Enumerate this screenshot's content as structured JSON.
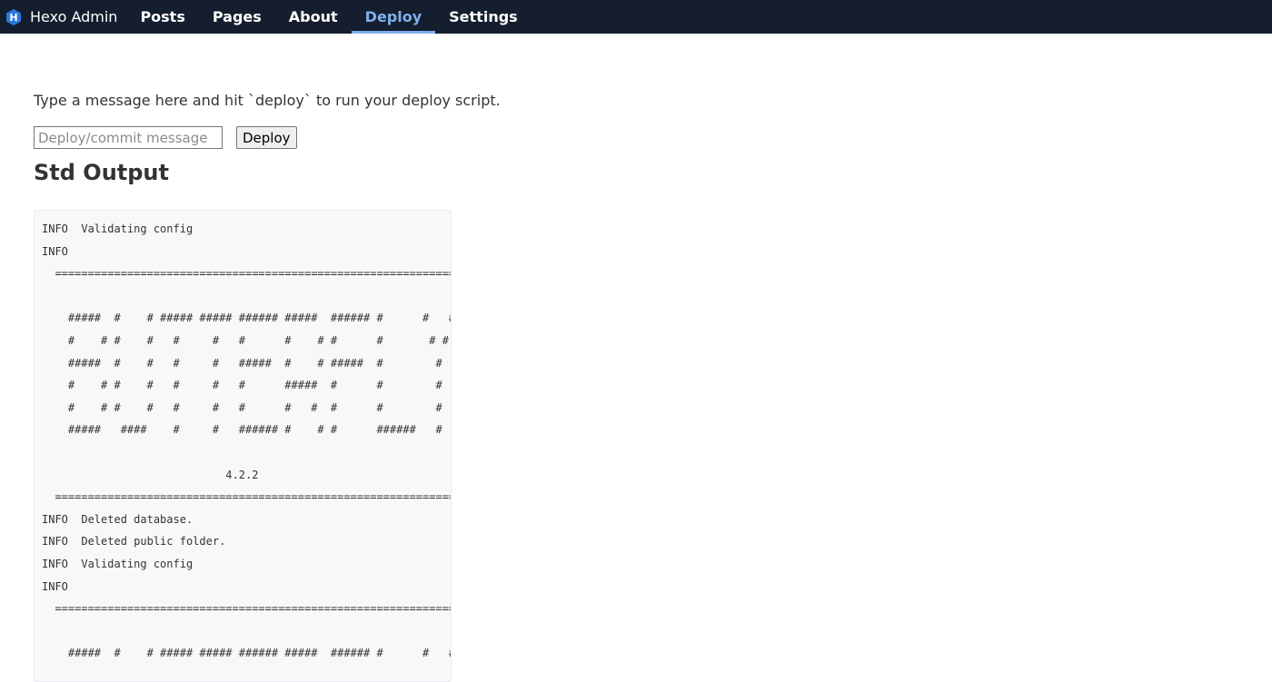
{
  "header": {
    "brand_logo_letter": "H",
    "brand_title": "Hexo Admin",
    "nav": [
      {
        "label": "Posts",
        "active": false
      },
      {
        "label": "Pages",
        "active": false
      },
      {
        "label": "About",
        "active": false
      },
      {
        "label": "Deploy",
        "active": true
      },
      {
        "label": "Settings",
        "active": false
      }
    ]
  },
  "deploy": {
    "instructions": "Type a message here and hit `deploy` to run your deploy script.",
    "message_placeholder": "Deploy/commit message",
    "message_value": "",
    "button_label": "Deploy"
  },
  "output": {
    "title": "Std Output",
    "text": "INFO  Validating config\nINFO\n  ===================================================================\n\n    #####  #    # ##### ##### ###### #####  ###### #      #   #\n    #    # #    #   #     #   #      #    # #      #       # #\n    #####  #    #   #     #   #####  #    # #####  #        #\n    #    # #    #   #     #   #      #####  #      #        #\n    #    # #    #   #     #   #      #   #  #      #        #\n    #####   ####    #     #   ###### #    # #      ######   #\n\n                            4.2.2\n  ===================================================================\nINFO  Deleted database.\nINFO  Deleted public folder.\nINFO  Validating config\nINFO\n  ===================================================================\n\n    #####  #    # ##### ##### ###### #####  ###### #      #   #"
  },
  "colors": {
    "topbar_bg": "#151e2e",
    "active_nav": "#7fb0ee",
    "logo_blue": "#2a7ade"
  }
}
